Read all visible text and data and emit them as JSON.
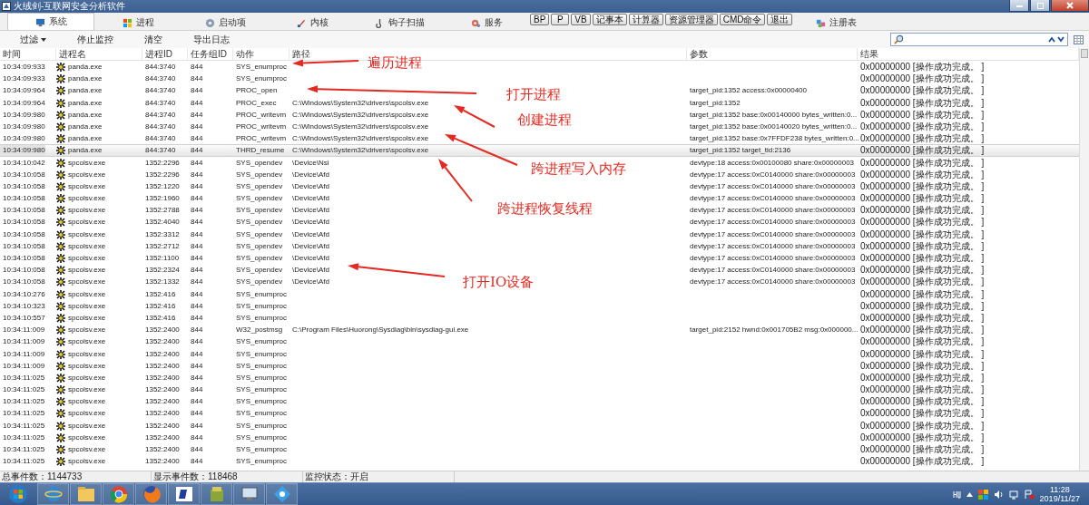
{
  "window": {
    "title": "火绒剑-互联网安全分析软件"
  },
  "tabs": [
    {
      "label": "系统",
      "selected": true
    },
    {
      "label": "进程",
      "selected": false
    },
    {
      "label": "启动项",
      "selected": false
    },
    {
      "label": "内核",
      "selected": false
    },
    {
      "label": "钩子扫描",
      "selected": false
    },
    {
      "label": "服务",
      "selected": false
    },
    {
      "label": "注册表",
      "selected": false
    }
  ],
  "quick_buttons": [
    "BP",
    "P",
    "VB",
    "记事本",
    "计算器",
    "资源管理器",
    "CMD命令",
    "退出"
  ],
  "toolbar": {
    "filter": "过滤",
    "actions": [
      "停止监控",
      "清空",
      "导出日志"
    ]
  },
  "table": {
    "columns": [
      "时间",
      "进程名",
      "进程ID",
      "任务组ID",
      "动作",
      "路径",
      "参数",
      "结果"
    ],
    "rows": [
      {
        "time": "10:34:09:933",
        "process": "panda.exe",
        "pid": "844:3740",
        "group": "844",
        "action": "SYS_enumproc",
        "result": "0x00000000 [操作成功完成。 ]",
        "selected": false
      },
      {
        "time": "10:34:09:933",
        "process": "panda.exe",
        "pid": "844:3740",
        "group": "844",
        "action": "SYS_enumproc",
        "result": "0x00000000 [操作成功完成。 ]",
        "selected": false
      },
      {
        "time": "10:34:09:964",
        "process": "panda.exe",
        "pid": "844:3740",
        "group": "844",
        "action": "PROC_open",
        "params": "target_pid:1352 access:0x00000400",
        "result": "0x00000000 [操作成功完成。 ]",
        "selected": false
      },
      {
        "time": "10:34:09:964",
        "process": "panda.exe",
        "pid": "844:3740",
        "group": "844",
        "action": "PROC_exec",
        "path": "C:\\Windows\\System32\\drivers\\spcolsv.exe",
        "params": "target_pid:1352",
        "result": "0x00000000 [操作成功完成。 ]",
        "selected": false
      },
      {
        "time": "10:34:09:980",
        "process": "panda.exe",
        "pid": "844:3740",
        "group": "844",
        "action": "PROC_writevm",
        "path": "C:\\Windows\\System32\\drivers\\spcolsv.exe",
        "params": "target_pid:1352 base:0x00140000 bytes_written:0...",
        "result": "0x00000000 [操作成功完成。 ]",
        "selected": false
      },
      {
        "time": "10:34:09:980",
        "process": "panda.exe",
        "pid": "844:3740",
        "group": "844",
        "action": "PROC_writevm",
        "path": "C:\\Windows\\System32\\drivers\\spcolsv.exe",
        "params": "target_pid:1352 base:0x00140020 bytes_written:0...",
        "result": "0x00000000 [操作成功完成。 ]",
        "selected": false
      },
      {
        "time": "10:34:09:980",
        "process": "panda.exe",
        "pid": "844:3740",
        "group": "844",
        "action": "PROC_writevm",
        "path": "C:\\Windows\\System32\\drivers\\spcolsv.exe",
        "params": "target_pid:1352 base:0x7FFDF238 bytes_written:0...",
        "result": "0x00000000 [操作成功完成。 ]",
        "selected": false
      },
      {
        "time": "10:34:09:980",
        "process": "panda.exe",
        "pid": "844:3740",
        "group": "844",
        "action": "THRD_resume",
        "path": "C:\\Windows\\System32\\drivers\\spcolsv.exe",
        "params": "target_pid:1352 target_tid:2136",
        "result": "0x00000000 [操作成功完成。 ]",
        "selected": true
      },
      {
        "time": "10:34:10:042",
        "process": "spcolsv.exe",
        "pid": "1352:2296",
        "group": "844",
        "action": "SYS_opendev",
        "path": "\\Device\\Nsi",
        "params": "devtype:18 access:0x00100080 share:0x00000003",
        "result": "0x00000000 [操作成功完成。 ]",
        "selected": false
      },
      {
        "time": "10:34:10:058",
        "process": "spcolsv.exe",
        "pid": "1352:2296",
        "group": "844",
        "action": "SYS_opendev",
        "path": "\\Device\\Afd",
        "params": "devtype:17 access:0xC0140000 share:0x00000003",
        "result": "0x00000000 [操作成功完成。 ]",
        "selected": false
      },
      {
        "time": "10:34:10:058",
        "process": "spcolsv.exe",
        "pid": "1352:1220",
        "group": "844",
        "action": "SYS_opendev",
        "path": "\\Device\\Afd",
        "params": "devtype:17 access:0xC0140000 share:0x00000003",
        "result": "0x00000000 [操作成功完成。 ]",
        "selected": false
      },
      {
        "time": "10:34:10:058",
        "process": "spcolsv.exe",
        "pid": "1352:1960",
        "group": "844",
        "action": "SYS_opendev",
        "path": "\\Device\\Afd",
        "params": "devtype:17 access:0xC0140000 share:0x00000003",
        "result": "0x00000000 [操作成功完成。 ]",
        "selected": false
      },
      {
        "time": "10:34:10:058",
        "process": "spcolsv.exe",
        "pid": "1352:2788",
        "group": "844",
        "action": "SYS_opendev",
        "path": "\\Device\\Afd",
        "params": "devtype:17 access:0xC0140000 share:0x00000003",
        "result": "0x00000000 [操作成功完成。 ]",
        "selected": false
      },
      {
        "time": "10:34:10:058",
        "process": "spcolsv.exe",
        "pid": "1352:4040",
        "group": "844",
        "action": "SYS_opendev",
        "path": "\\Device\\Afd",
        "params": "devtype:17 access:0xC0140000 share:0x00000003",
        "result": "0x00000000 [操作成功完成。 ]",
        "selected": false
      },
      {
        "time": "10:34:10:058",
        "process": "spcolsv.exe",
        "pid": "1352:3312",
        "group": "844",
        "action": "SYS_opendev",
        "path": "\\Device\\Afd",
        "params": "devtype:17 access:0xC0140000 share:0x00000003",
        "result": "0x00000000 [操作成功完成。 ]",
        "selected": false
      },
      {
        "time": "10:34:10:058",
        "process": "spcolsv.exe",
        "pid": "1352:2712",
        "group": "844",
        "action": "SYS_opendev",
        "path": "\\Device\\Afd",
        "params": "devtype:17 access:0xC0140000 share:0x00000003",
        "result": "0x00000000 [操作成功完成。 ]",
        "selected": false
      },
      {
        "time": "10:34:10:058",
        "process": "spcolsv.exe",
        "pid": "1352:1100",
        "group": "844",
        "action": "SYS_opendev",
        "path": "\\Device\\Afd",
        "params": "devtype:17 access:0xC0140000 share:0x00000003",
        "result": "0x00000000 [操作成功完成。 ]",
        "selected": false
      },
      {
        "time": "10:34:10:058",
        "process": "spcolsv.exe",
        "pid": "1352:2324",
        "group": "844",
        "action": "SYS_opendev",
        "path": "\\Device\\Afd",
        "params": "devtype:17 access:0xC0140000 share:0x00000003",
        "result": "0x00000000 [操作成功完成。 ]",
        "selected": false
      },
      {
        "time": "10:34:10:058",
        "process": "spcolsv.exe",
        "pid": "1352:1332",
        "group": "844",
        "action": "SYS_opendev",
        "path": "\\Device\\Afd",
        "params": "devtype:17 access:0xC0140000 share:0x00000003",
        "result": "0x00000000 [操作成功完成。 ]",
        "selected": false
      },
      {
        "time": "10:34:10:276",
        "process": "spcolsv.exe",
        "pid": "1352:416",
        "group": "844",
        "action": "SYS_enumproc",
        "result": "0x00000000 [操作成功完成。 ]",
        "selected": false
      },
      {
        "time": "10:34:10:323",
        "process": "spcolsv.exe",
        "pid": "1352:416",
        "group": "844",
        "action": "SYS_enumproc",
        "result": "0x00000000 [操作成功完成。 ]",
        "selected": false
      },
      {
        "time": "10:34:10:557",
        "process": "spcolsv.exe",
        "pid": "1352:416",
        "group": "844",
        "action": "SYS_enumproc",
        "result": "0x00000000 [操作成功完成。 ]",
        "selected": false
      },
      {
        "time": "10:34:11:009",
        "process": "spcolsv.exe",
        "pid": "1352:2400",
        "group": "844",
        "action": "W32_postmsg",
        "path": "C:\\Program Files\\Huorong\\Sysdiag\\bin\\sysdiag-gui.exe",
        "params": "target_pid:2152 hwnd:0x001705B2 msg:0x000000...",
        "result": "0x00000000 [操作成功完成。 ]",
        "selected": false
      },
      {
        "time": "10:34:11:009",
        "process": "spcolsv.exe",
        "pid": "1352:2400",
        "group": "844",
        "action": "SYS_enumproc",
        "result": "0x00000000 [操作成功完成。 ]",
        "selected": false
      },
      {
        "time": "10:34:11:009",
        "process": "spcolsv.exe",
        "pid": "1352:2400",
        "group": "844",
        "action": "SYS_enumproc",
        "result": "0x00000000 [操作成功完成。 ]",
        "selected": false
      },
      {
        "time": "10:34:11:009",
        "process": "spcolsv.exe",
        "pid": "1352:2400",
        "group": "844",
        "action": "SYS_enumproc",
        "result": "0x00000000 [操作成功完成。 ]",
        "selected": false
      },
      {
        "time": "10:34:11:025",
        "process": "spcolsv.exe",
        "pid": "1352:2400",
        "group": "844",
        "action": "SYS_enumproc",
        "result": "0x00000000 [操作成功完成。 ]",
        "selected": false
      },
      {
        "time": "10:34:11:025",
        "process": "spcolsv.exe",
        "pid": "1352:2400",
        "group": "844",
        "action": "SYS_enumproc",
        "result": "0x00000000 [操作成功完成。 ]",
        "selected": false
      },
      {
        "time": "10:34:11:025",
        "process": "spcolsv.exe",
        "pid": "1352:2400",
        "group": "844",
        "action": "SYS_enumproc",
        "result": "0x00000000 [操作成功完成。 ]",
        "selected": false
      },
      {
        "time": "10:34:11:025",
        "process": "spcolsv.exe",
        "pid": "1352:2400",
        "group": "844",
        "action": "SYS_enumproc",
        "result": "0x00000000 [操作成功完成。 ]",
        "selected": false
      },
      {
        "time": "10:34:11:025",
        "process": "spcolsv.exe",
        "pid": "1352:2400",
        "group": "844",
        "action": "SYS_enumproc",
        "result": "0x00000000 [操作成功完成。 ]",
        "selected": false
      },
      {
        "time": "10:34:11:025",
        "process": "spcolsv.exe",
        "pid": "1352:2400",
        "group": "844",
        "action": "SYS_enumproc",
        "result": "0x00000000 [操作成功完成。 ]",
        "selected": false
      },
      {
        "time": "10:34:11:025",
        "process": "spcolsv.exe",
        "pid": "1352:2400",
        "group": "844",
        "action": "SYS_enumproc",
        "result": "0x00000000 [操作成功完成。 ]",
        "selected": false
      },
      {
        "time": "10:34:11:025",
        "process": "spcolsv.exe",
        "pid": "1352:2400",
        "group": "844",
        "action": "SYS_enumproc",
        "result": "0x00000000 [操作成功完成。 ]",
        "selected": false
      }
    ]
  },
  "annotations": [
    "遍历进程",
    "打开进程",
    "创建进程",
    "跨进程写入内存",
    "跨进程恢复线程",
    "打开IO设备"
  ],
  "status_bar": [
    "总事件数：1144733",
    "显示事件数：118468",
    "监控状态：开启"
  ],
  "taskbar": {
    "time": "11:28",
    "date": "2019/11/27"
  }
}
